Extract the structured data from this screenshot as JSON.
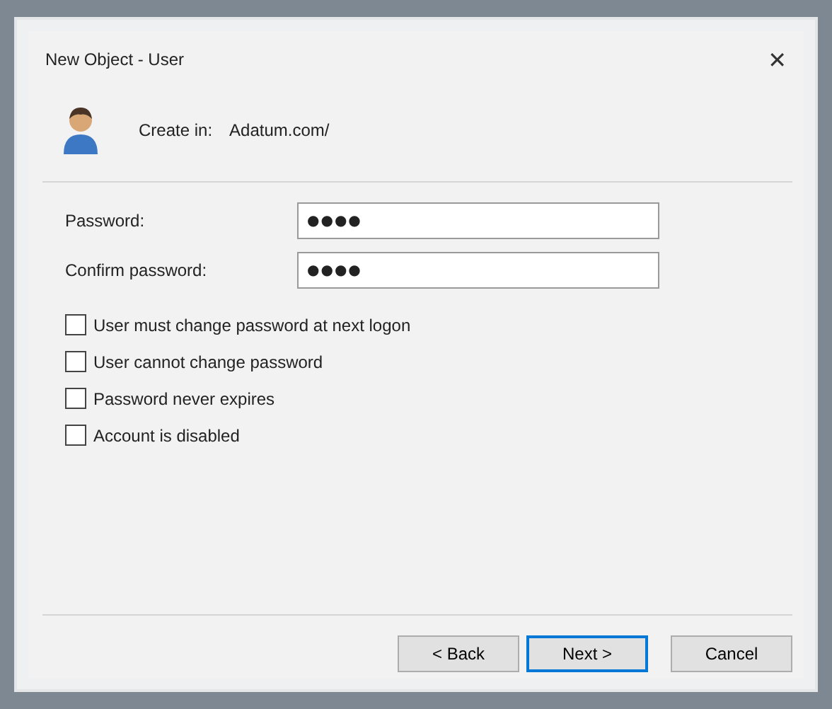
{
  "window": {
    "title": "New Object - User",
    "close": "✕"
  },
  "create_in": {
    "label": "Create in:",
    "value": "Adatum.com/"
  },
  "fields": [
    {
      "label": "Password:",
      "value": "●●●●"
    },
    {
      "label": "Confirm password:",
      "value": "●●●●"
    }
  ],
  "options": [
    {
      "label": "User must change password at next logon",
      "checked": false
    },
    {
      "label": "User cannot change password",
      "checked": false
    },
    {
      "label": "Password never expires",
      "checked": false
    },
    {
      "label": "Account is disabled",
      "checked": false
    }
  ],
  "buttons": [
    {
      "label": "< Back",
      "default": false
    },
    {
      "label": "Next >",
      "default": true
    },
    {
      "label": "Cancel",
      "default": false
    }
  ]
}
